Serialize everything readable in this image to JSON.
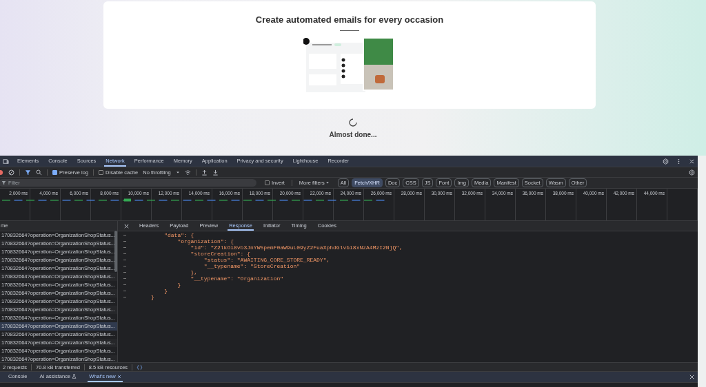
{
  "page": {
    "card_title": "Create automated emails for every occasion",
    "loading_text": "Almost done..."
  },
  "devtools": {
    "tabs": [
      {
        "label": "Elements",
        "selected": false
      },
      {
        "label": "Console",
        "selected": false
      },
      {
        "label": "Sources",
        "selected": false
      },
      {
        "label": "Network",
        "selected": true
      },
      {
        "label": "Performance",
        "selected": false
      },
      {
        "label": "Memory",
        "selected": false
      },
      {
        "label": "Application",
        "selected": false
      },
      {
        "label": "Privacy and security",
        "selected": false
      },
      {
        "label": "Lighthouse",
        "selected": false
      },
      {
        "label": "Recorder",
        "selected": false
      }
    ],
    "toolbar": {
      "preserve_log": {
        "label": "Preserve log",
        "checked": true
      },
      "disable_cache": {
        "label": "Disable cache",
        "checked": false
      },
      "throttling": "No throttling"
    },
    "filter": {
      "placeholder": "Filter",
      "invert": {
        "label": "Invert",
        "checked": false
      },
      "more_filters": "More filters",
      "types": [
        {
          "label": "All",
          "selected": false
        },
        {
          "label": "Fetch/XHR",
          "selected": true
        },
        {
          "label": "Doc",
          "selected": false
        },
        {
          "label": "CSS",
          "selected": false
        },
        {
          "label": "JS",
          "selected": false
        },
        {
          "label": "Font",
          "selected": false
        },
        {
          "label": "Img",
          "selected": false
        },
        {
          "label": "Media",
          "selected": false
        },
        {
          "label": "Manifest",
          "selected": false
        },
        {
          "label": "Socket",
          "selected": false
        },
        {
          "label": "Wasm",
          "selected": false
        },
        {
          "label": "Other",
          "selected": false
        }
      ]
    },
    "timeline_ticks": [
      "2,000 ms",
      "4,000 ms",
      "6,000 ms",
      "8,000 ms",
      "10,000 ms",
      "12,000 ms",
      "14,000 ms",
      "16,000 ms",
      "18,000 ms",
      "20,000 ms",
      "22,000 ms",
      "24,000 ms",
      "26,000 ms",
      "28,000 ms",
      "30,000 ms",
      "32,000 ms",
      "34,000 ms",
      "36,000 ms",
      "38,000 ms",
      "40,000 ms",
      "42,000 ms",
      "44,000 ms"
    ],
    "requests": {
      "header": "me",
      "rows": [
        {
          "name": "170832664?operation=OrganizationShopStatus...",
          "selected": false
        },
        {
          "name": "170832664?operation=OrganizationShopStatus...",
          "selected": false
        },
        {
          "name": "170832664?operation=OrganizationShopStatus...",
          "selected": false
        },
        {
          "name": "170832664?operation=OrganizationShopStatus...",
          "selected": false
        },
        {
          "name": "170832664?operation=OrganizationShopStatus...",
          "selected": false
        },
        {
          "name": "170832664?operation=OrganizationShopStatus...",
          "selected": false
        },
        {
          "name": "170832664?operation=OrganizationShopStatus...",
          "selected": false
        },
        {
          "name": "170832664?operation=OrganizationShopStatus...",
          "selected": false
        },
        {
          "name": "170832664?operation=OrganizationShopStatus...",
          "selected": false
        },
        {
          "name": "170832664?operation=OrganizationShopStatus...",
          "selected": false
        },
        {
          "name": "170832664?operation=OrganizationShopStatus...",
          "selected": false
        },
        {
          "name": "170832664?operation=OrganizationShopStatus...",
          "selected": true
        },
        {
          "name": "170832664?operation=OrganizationShopStatus...",
          "selected": false
        },
        {
          "name": "170832664?operation=OrganizationShopStatus...",
          "selected": false
        },
        {
          "name": "170832664?operation=OrganizationShopStatus...",
          "selected": false
        },
        {
          "name": "170832664?operation=OrganizationShopStatus...",
          "selected": false
        }
      ]
    },
    "detail_tabs": [
      {
        "label": "Headers",
        "selected": false
      },
      {
        "label": "Payload",
        "selected": false
      },
      {
        "label": "Preview",
        "selected": false
      },
      {
        "label": "Response",
        "selected": true
      },
      {
        "label": "Initiator",
        "selected": false
      },
      {
        "label": "Timing",
        "selected": false
      },
      {
        "label": "Cookies",
        "selected": false
      }
    ],
    "response_lines": [
      "    \"data\": {",
      "        \"organization\": {",
      "            \"id\": \"Z2lkOi8vb3JnYW5pemF0aW9uL09yZ2FuaXphdGlvbi8xNzA4MzI2NjQ\",",
      "            \"storeCreation\": {",
      "                \"status\": \"AWAITING_CORE_STORE_READY\",",
      "                \"__typename\": \"StoreCreation\"",
      "            },",
      "            \"__typename\": \"Organization\"",
      "        }",
      "    }",
      "}"
    ],
    "summary": [
      "2 requests",
      "70.8 kB transferred",
      "8.5 kB resources"
    ],
    "drawer_tabs": [
      {
        "label": "Console",
        "selected": false
      },
      {
        "label": "AI assistance",
        "selected": false
      },
      {
        "label": "What's new",
        "selected": true
      }
    ]
  }
}
